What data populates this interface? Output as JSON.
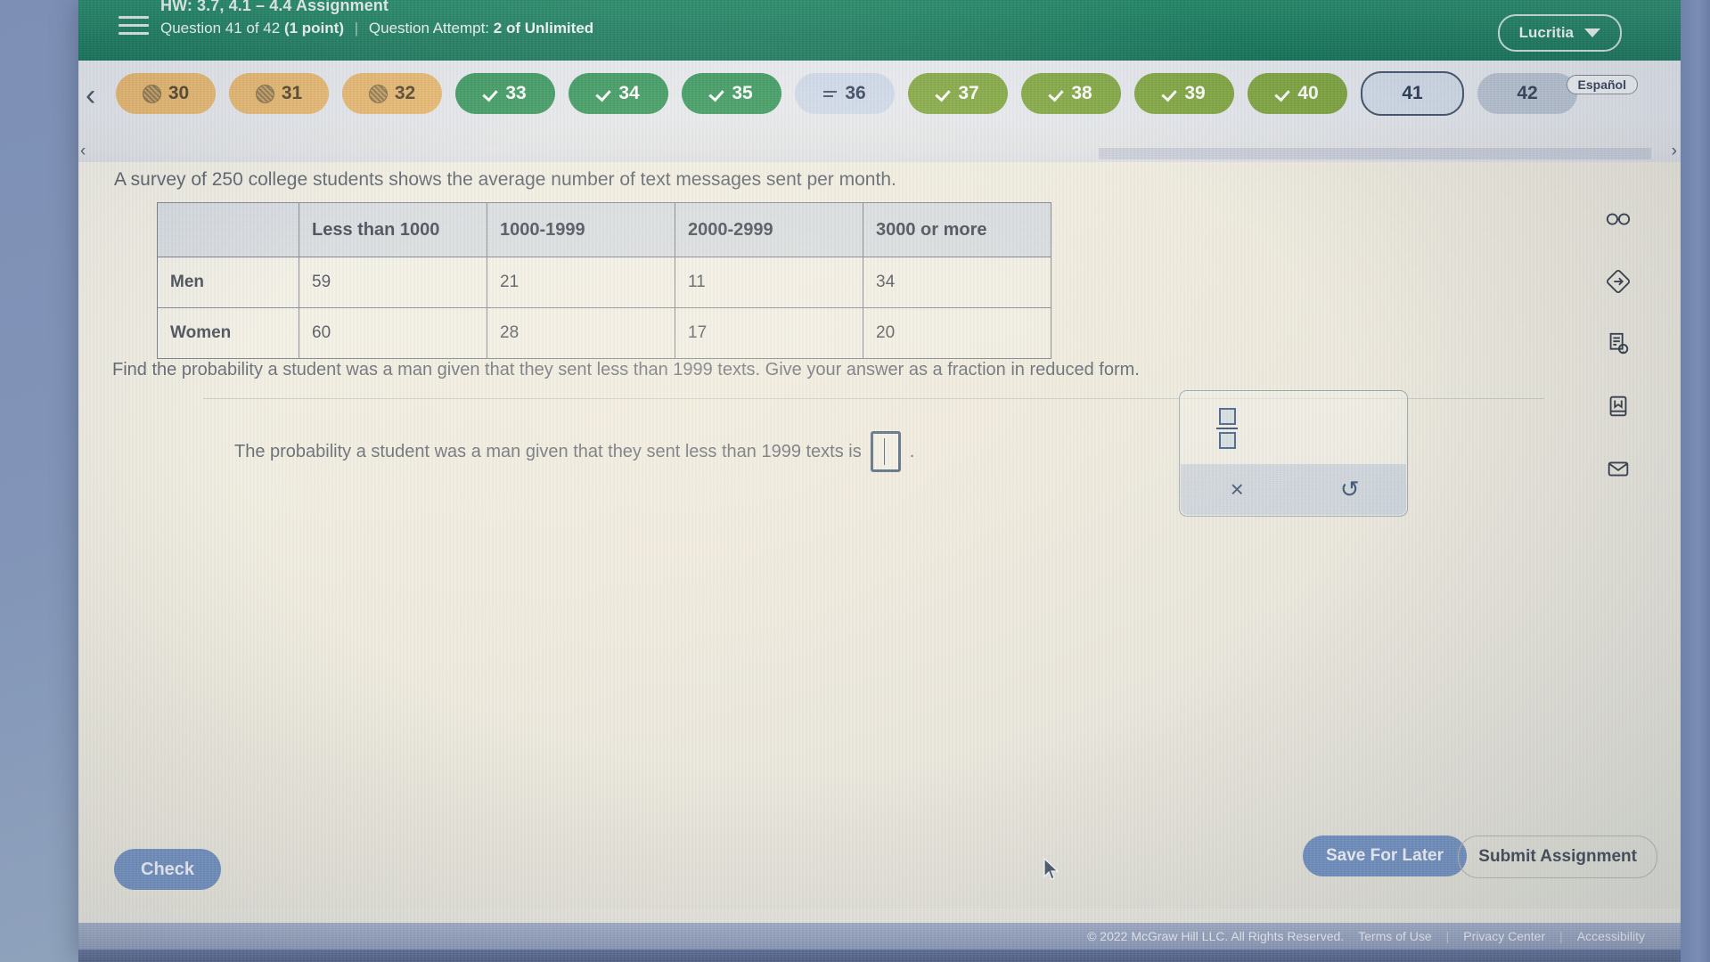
{
  "header": {
    "assignment_title": "HW: 3.7, 4.1 – 4.4 Assignment",
    "question_label": "Question 41 of 42",
    "points": "(1 point)",
    "attempt_prefix": "Question Attempt:",
    "attempt_value": "2 of Unlimited",
    "user_name": "Lucritia",
    "brand_green": "#14795a"
  },
  "nav": {
    "prev_arrow": "‹",
    "espanol_label": "Español",
    "scroll_left_arrow": "‹",
    "scroll_right_arrow": "›",
    "pills": [
      {
        "label": "30",
        "state": "incomplete",
        "icon": "hatched-circle-icon"
      },
      {
        "label": "31",
        "state": "incomplete",
        "icon": "hatched-circle-icon"
      },
      {
        "label": "32",
        "state": "incomplete",
        "icon": "hatched-circle-icon"
      },
      {
        "label": "33",
        "state": "correct",
        "icon": "check-icon"
      },
      {
        "label": "34",
        "state": "correct",
        "icon": "check-icon"
      },
      {
        "label": "35",
        "state": "correct",
        "icon": "check-icon"
      },
      {
        "label": "36",
        "state": "partial",
        "icon": "equals-icon"
      },
      {
        "label": "37",
        "state": "complete",
        "icon": "check-icon"
      },
      {
        "label": "38",
        "state": "complete",
        "icon": "check-icon"
      },
      {
        "label": "39",
        "state": "complete",
        "icon": "check-icon"
      },
      {
        "label": "40",
        "state": "complete",
        "icon": "check-icon"
      },
      {
        "label": "41",
        "state": "current",
        "icon": "none"
      },
      {
        "label": "42",
        "state": "unvisited",
        "icon": "none"
      }
    ]
  },
  "question": {
    "intro": "A survey of 250 college students shows the average number of text messages sent per month.",
    "prompt": "Find the probability a student was a man given that they sent less than 1999 texts. Give your answer as a fraction in reduced form.",
    "answer_sentence": "The probability a student was a man given that they sent less than 1999 texts is",
    "answer_value": "",
    "answer_suffix": "."
  },
  "table": {
    "corner": "",
    "columns": [
      "Less than 1000",
      "1000-1999",
      "2000-2999",
      "3000 or more"
    ],
    "rows": [
      {
        "label": "Men",
        "values": [
          "59",
          "21",
          "11",
          "34"
        ]
      },
      {
        "label": "Women",
        "values": [
          "60",
          "28",
          "17",
          "20"
        ]
      }
    ]
  },
  "math_palette": {
    "fraction_button": "fraction-template",
    "times_symbol": "×",
    "undo_symbol": "↺"
  },
  "tools": [
    {
      "name": "glasses-icon",
      "title": "Reading aid"
    },
    {
      "name": "diamond-arrow-icon",
      "title": "Skip"
    },
    {
      "name": "document-lightbulb-icon",
      "title": "Hint"
    },
    {
      "name": "reference-book-icon",
      "title": "Reference"
    },
    {
      "name": "envelope-icon",
      "title": "Message"
    }
  ],
  "actions": {
    "check": "Check",
    "save_for_later": "Save For Later",
    "submit_assignment": "Submit Assignment"
  },
  "footer": {
    "copyright": "© 2022 McGraw Hill LLC. All Rights Reserved.",
    "terms": "Terms of Use",
    "privacy": "Privacy Center",
    "accessibility": "Accessibility",
    "divider": "|"
  }
}
